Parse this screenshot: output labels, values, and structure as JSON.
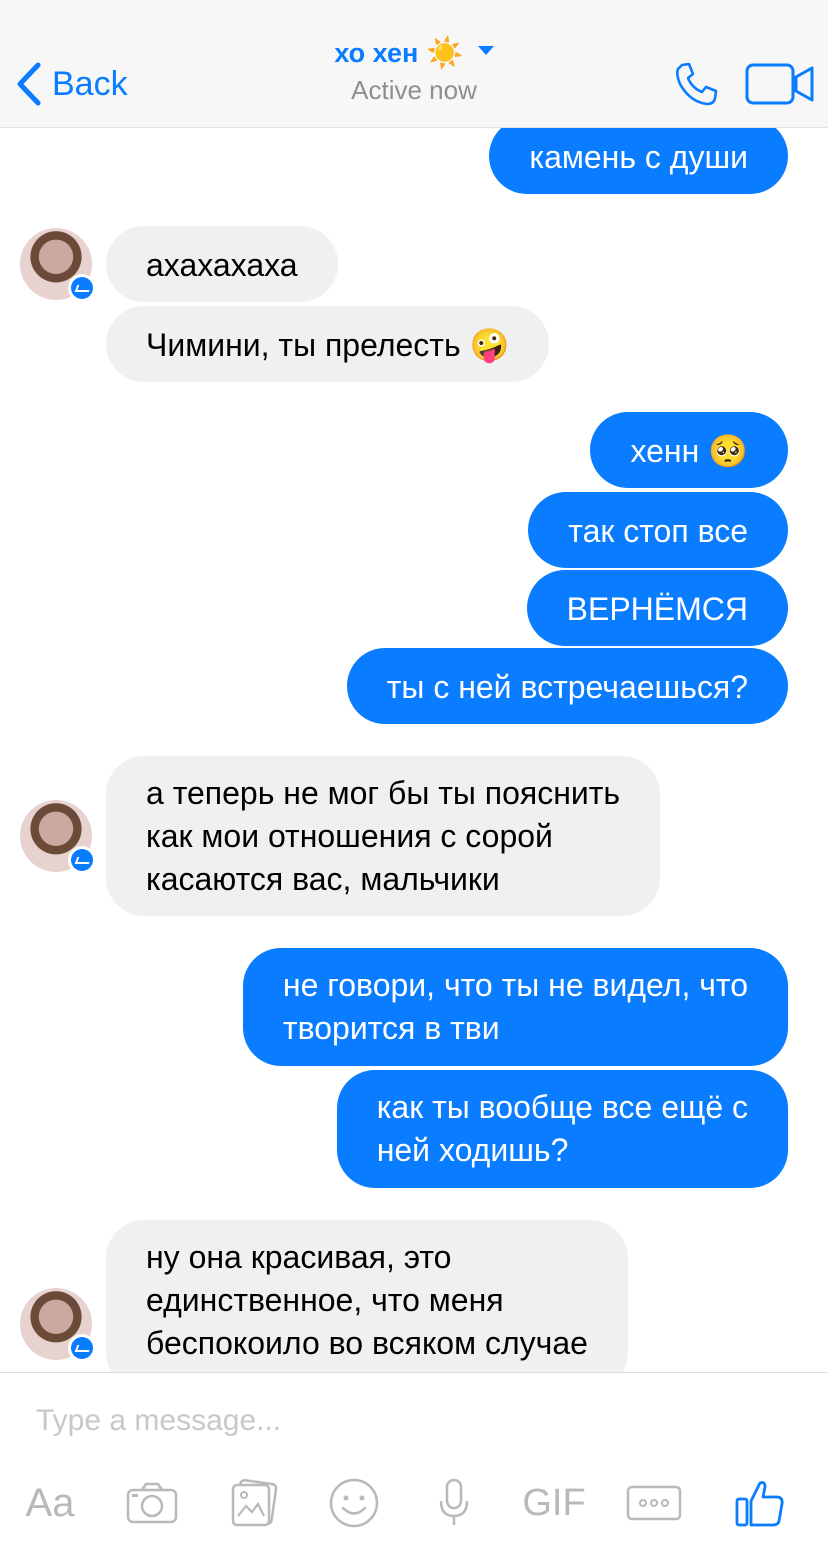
{
  "header": {
    "back_label": "Back",
    "contact_name": "хо хен",
    "contact_emoji": "☀️",
    "status": "Active now"
  },
  "messages": [
    {
      "side": "out",
      "text": "камень с души"
    },
    {
      "side": "in",
      "text": "ахахахаха"
    },
    {
      "side": "in",
      "text": "Чимини, ты прелесть",
      "emoji": "🤪"
    },
    {
      "side": "out",
      "text": "хенн",
      "emoji": "🥺"
    },
    {
      "side": "out",
      "text": "так стоп все"
    },
    {
      "side": "out",
      "text": "ВЕРНЁМСЯ"
    },
    {
      "side": "out",
      "text": "ты с ней встречаешься?"
    },
    {
      "side": "in",
      "lines": [
        "а теперь не мог бы ты пояснить",
        "как мои отношения с сорой",
        "касаются вас, мальчики"
      ]
    },
    {
      "side": "out",
      "lines": [
        "не говори, что ты не видел, что",
        "творится в тви"
      ]
    },
    {
      "side": "out",
      "lines": [
        "как ты вообще все ещё с",
        "ней ходишь?"
      ]
    },
    {
      "side": "in",
      "lines": [
        "ну она красивая, это",
        "единственное, что меня",
        "беспокоило во всяком случае"
      ]
    }
  ],
  "composer": {
    "placeholder": "Type a message...",
    "aa_label": "Aa",
    "gif_label": "GIF"
  },
  "icons": [
    "back-chevron-icon",
    "dropdown-caret-icon",
    "phone-icon",
    "video-camera-icon",
    "camera-icon",
    "gallery-icon",
    "emoji-icon",
    "microphone-icon",
    "more-icon",
    "like-icon",
    "messenger-badge-icon"
  ],
  "colors": {
    "accent": "#0a7cff",
    "incoming_bubble": "#f0f0f0",
    "header_bg": "#f7f7f7",
    "status_gray": "#8e8e93",
    "toolbar_gray": "#b8b8bd"
  }
}
